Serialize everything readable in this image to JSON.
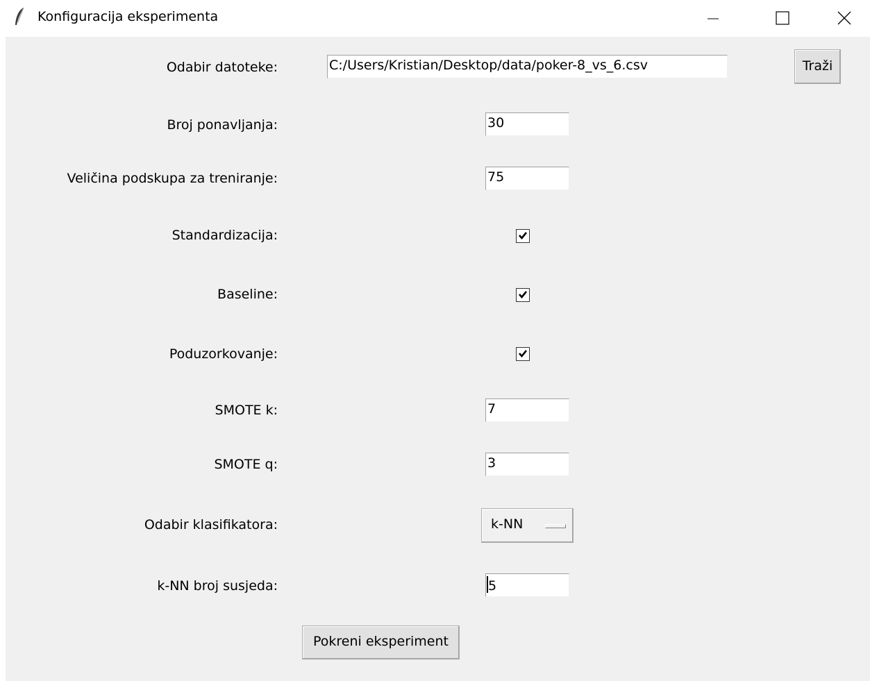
{
  "window": {
    "title": "Konfiguracija eksperimenta",
    "icon": "feather-icon",
    "controls": [
      "minimize-icon",
      "maximize-icon",
      "close-icon"
    ]
  },
  "form": {
    "file": {
      "label": "Odabir datoteke:",
      "value": "C:/Users/Kristian/Desktop/data/poker-8_vs_6.csv",
      "browse_label": "Traži"
    },
    "repetitions": {
      "label": "Broj ponavljanja:",
      "value": "30"
    },
    "train_size": {
      "label": "Veličina podskupa za treniranje:",
      "value": "75"
    },
    "standardization": {
      "label": "Standardizacija:",
      "checked": true
    },
    "baseline": {
      "label": "Baseline:",
      "checked": true
    },
    "undersampling": {
      "label": "Poduzorkovanje:",
      "checked": true
    },
    "smote_k": {
      "label": "SMOTE k:",
      "value": "7"
    },
    "smote_q": {
      "label": "SMOTE q:",
      "value": "3"
    },
    "classifier": {
      "label": "Odabir klasifikatora:",
      "selected": "k-NN"
    },
    "knn_neighbors": {
      "label": "k-NN broj susjeda:",
      "value": "5"
    },
    "run_label": "Pokreni eksperiment"
  }
}
